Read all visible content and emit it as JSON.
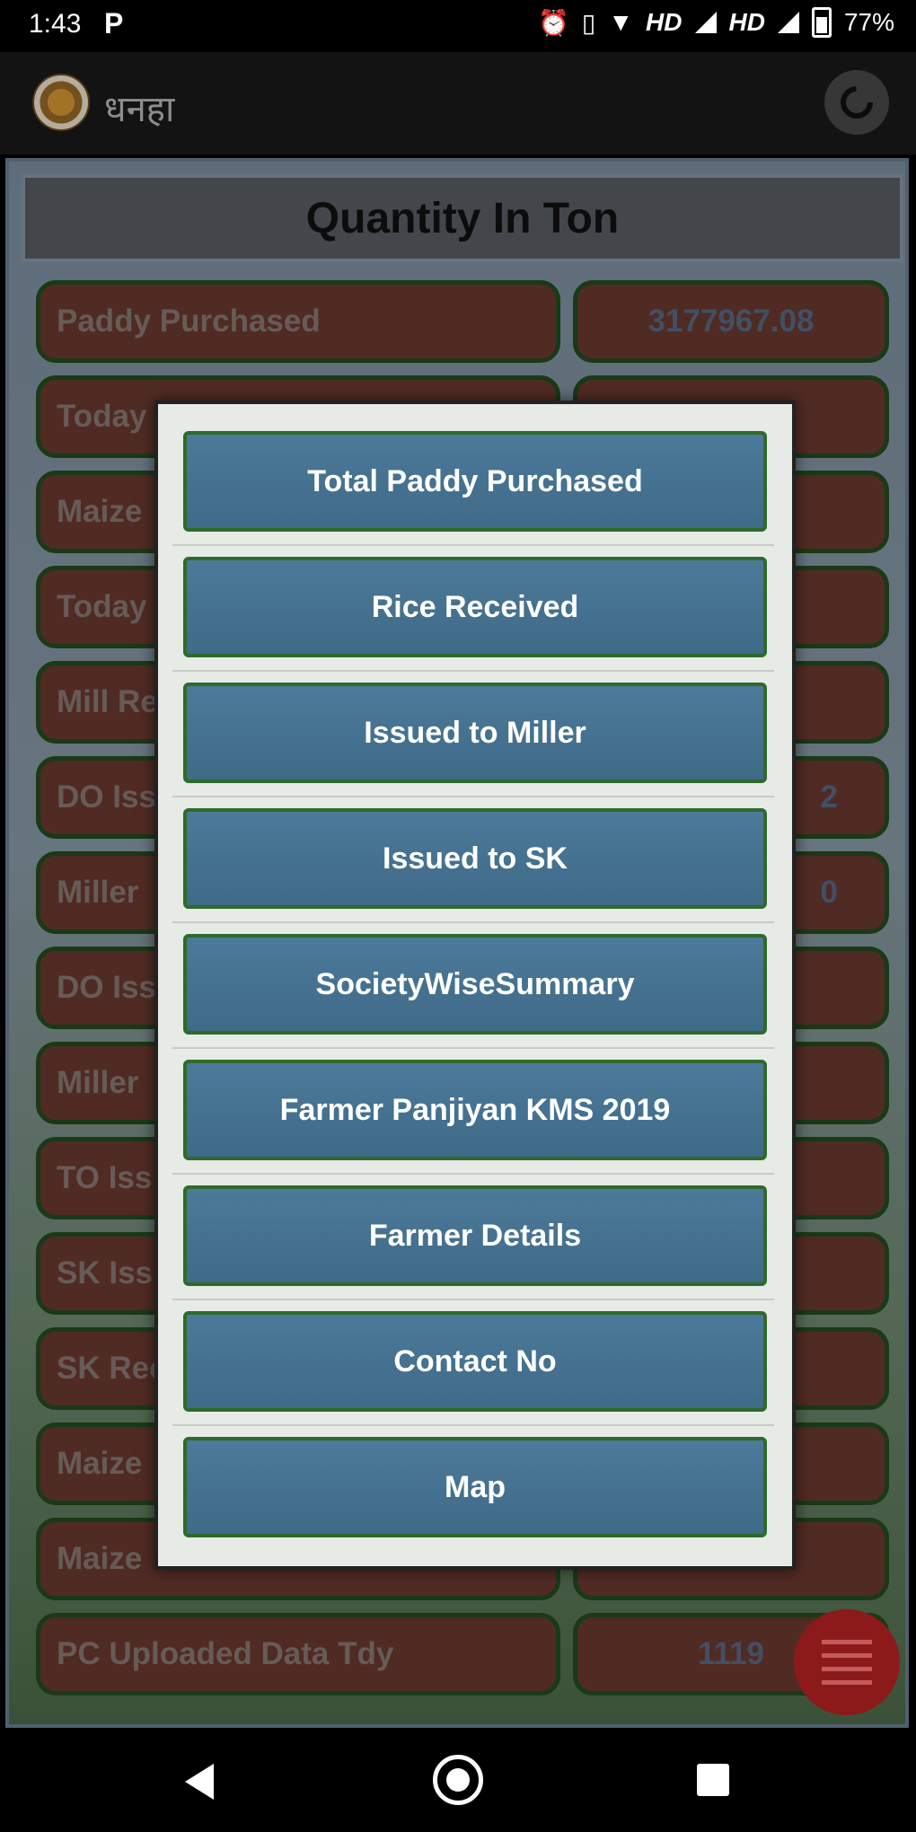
{
  "status_bar": {
    "time": "1:43",
    "left_icon": "P",
    "network_1": "HD",
    "network_2": "HD",
    "battery": "77%",
    "icons": [
      "alarm-icon",
      "vibrate-icon",
      "wifi-icon",
      "signal-icon",
      "battery-icon"
    ]
  },
  "app_bar": {
    "title": "धनहा",
    "logo_icon": "emblem-logo",
    "refresh_icon": "refresh-icon"
  },
  "main": {
    "header": "Quantity In Ton",
    "rows": [
      {
        "label": "Paddy Purchased",
        "value": "3177967.08"
      },
      {
        "label": "Today",
        "value": ""
      },
      {
        "label": "Maize",
        "value": ""
      },
      {
        "label": "Today",
        "value": ""
      },
      {
        "label": "Mill Re",
        "value": ""
      },
      {
        "label": "DO Iss",
        "value": "2"
      },
      {
        "label": "Miller",
        "value": "0"
      },
      {
        "label": "DO Iss",
        "value": ""
      },
      {
        "label": "Miller",
        "value": ""
      },
      {
        "label": "TO Iss",
        "value": ""
      },
      {
        "label": "SK Iss",
        "value": ""
      },
      {
        "label": "SK Rec",
        "value": ""
      },
      {
        "label": "Maize",
        "value": ""
      },
      {
        "label": "Maize",
        "value": ""
      },
      {
        "label": "PC Uploaded Data Tdy",
        "value": "1119"
      }
    ]
  },
  "dialog": {
    "items": [
      "Total Paddy Purchased",
      "Rice Received",
      "Issued to Miller",
      "Issued to SK",
      "SocietyWiseSummary",
      "Farmer Panjiyan KMS 2019",
      "Farmer Details",
      "Contact No",
      "Map"
    ]
  },
  "fab": {
    "icon": "menu-icon"
  },
  "nav_bar": {
    "icons": [
      "back-icon",
      "home-icon",
      "recents-icon"
    ]
  },
  "colors": {
    "button_bg": "#457191",
    "button_border": "#2f6a2a",
    "cell_bg": "#6b3a2f",
    "fab": "#8d1a1a"
  }
}
